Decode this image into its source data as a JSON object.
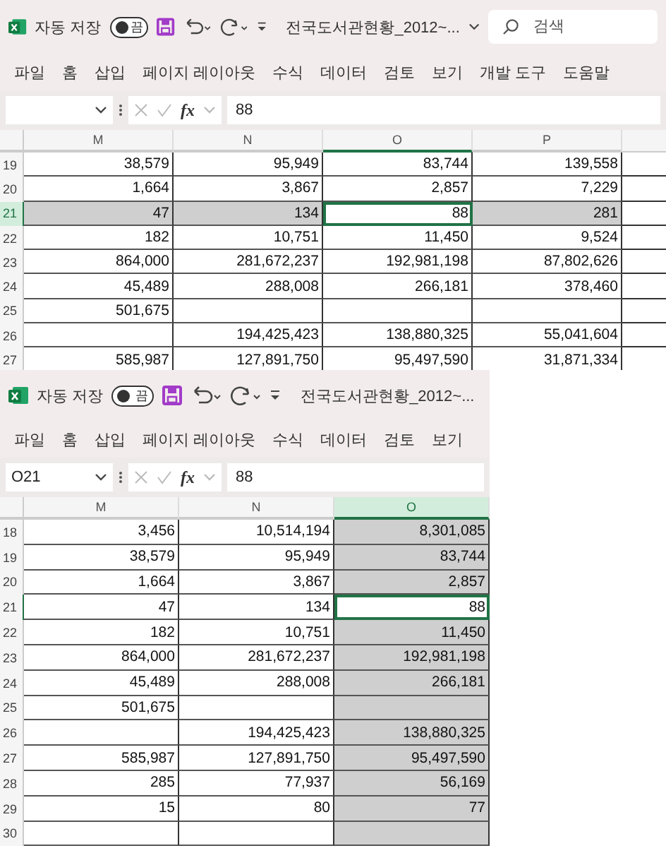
{
  "windows": [
    {
      "autosave": {
        "label": "자동 저장",
        "state": "끔",
        "on": false
      },
      "title": "전국도서관현황_2012~...",
      "search": {
        "placeholder": "검색"
      },
      "menu": [
        "파일",
        "홈",
        "삽입",
        "페이지 레이아웃",
        "수식",
        "데이터",
        "검토",
        "보기",
        "개발 도구",
        "도움말"
      ],
      "function_label": "fx",
      "formula": "88",
      "columns": [
        {
          "label": "M",
          "selected": false,
          "active": false
        },
        {
          "label": "N",
          "selected": false,
          "active": false
        },
        {
          "label": "O",
          "selected": false,
          "active": true
        },
        {
          "label": "P",
          "selected": false,
          "active": false
        }
      ],
      "rows": [
        {
          "number": "19",
          "selected": false,
          "active": false,
          "cells": [
            "38,579",
            "95,949",
            "83,744",
            "139,558"
          ]
        },
        {
          "number": "20",
          "selected": false,
          "active": false,
          "cells": [
            "1,664",
            "3,867",
            "2,857",
            "7,229"
          ]
        },
        {
          "number": "21",
          "selected": true,
          "active": true,
          "cells": [
            "47",
            "134",
            "88",
            "281"
          ]
        },
        {
          "number": "22",
          "selected": false,
          "active": false,
          "cells": [
            "182",
            "10,751",
            "11,450",
            "9,524"
          ]
        },
        {
          "number": "23",
          "selected": false,
          "active": false,
          "cells": [
            "864,000",
            "281,672,237",
            "192,981,198",
            "87,802,626"
          ]
        },
        {
          "number": "24",
          "selected": false,
          "active": false,
          "cells": [
            "45,489",
            "288,008",
            "266,181",
            "378,460"
          ]
        },
        {
          "number": "25",
          "selected": false,
          "active": false,
          "cells": [
            "501,675",
            null,
            null,
            null
          ]
        },
        {
          "number": "26",
          "selected": false,
          "active": false,
          "cells": [
            null,
            "194,425,423",
            "138,880,325",
            "55,041,604"
          ]
        },
        {
          "number": "27",
          "selected": false,
          "active": false,
          "cells": [
            "585,987",
            "127,891,750",
            "95,497,590",
            "31,871,334"
          ]
        }
      ]
    },
    {
      "autosave": {
        "label": "자동 저장",
        "state": "끔",
        "on": false
      },
      "title": "전국도서관현황_2012~...",
      "menu": [
        "파일",
        "홈",
        "삽입",
        "페이지 레이아웃",
        "수식",
        "데이터",
        "검토",
        "보기"
      ],
      "name_box": "O21",
      "function_label": "fx",
      "formula": "88",
      "columns": [
        {
          "label": "M",
          "selected": false,
          "active": false
        },
        {
          "label": "N",
          "selected": false,
          "active": false
        },
        {
          "label": "O",
          "selected": true,
          "active": true
        }
      ],
      "rows": [
        {
          "number": "18",
          "selected": false,
          "active": false,
          "cells": [
            "3,456",
            "10,514,194",
            "8,301,085"
          ]
        },
        {
          "number": "19",
          "selected": false,
          "active": false,
          "cells": [
            "38,579",
            "95,949",
            "83,744"
          ]
        },
        {
          "number": "20",
          "selected": false,
          "active": false,
          "cells": [
            "1,664",
            "3,867",
            "2,857"
          ]
        },
        {
          "number": "21",
          "selected": false,
          "active": true,
          "cells": [
            "47",
            "134",
            "88"
          ]
        },
        {
          "number": "22",
          "selected": false,
          "active": false,
          "cells": [
            "182",
            "10,751",
            "11,450"
          ]
        },
        {
          "number": "23",
          "selected": false,
          "active": false,
          "cells": [
            "864,000",
            "281,672,237",
            "192,981,198"
          ]
        },
        {
          "number": "24",
          "selected": false,
          "active": false,
          "cells": [
            "45,489",
            "288,008",
            "266,181"
          ]
        },
        {
          "number": "25",
          "selected": false,
          "active": false,
          "cells": [
            "501,675",
            null,
            null
          ]
        },
        {
          "number": "26",
          "selected": false,
          "active": false,
          "cells": [
            null,
            "194,425,423",
            "138,880,325"
          ]
        },
        {
          "number": "27",
          "selected": false,
          "active": false,
          "cells": [
            "585,987",
            "127,891,750",
            "95,497,590"
          ]
        },
        {
          "number": "28",
          "selected": false,
          "active": false,
          "cells": [
            "285",
            "77,937",
            "56,169"
          ]
        },
        {
          "number": "29",
          "selected": false,
          "active": false,
          "cells": [
            "15",
            "80",
            "77"
          ]
        },
        {
          "number": "30",
          "selected": false,
          "active": false,
          "cells": [
            null,
            null,
            null
          ]
        }
      ]
    }
  ]
}
